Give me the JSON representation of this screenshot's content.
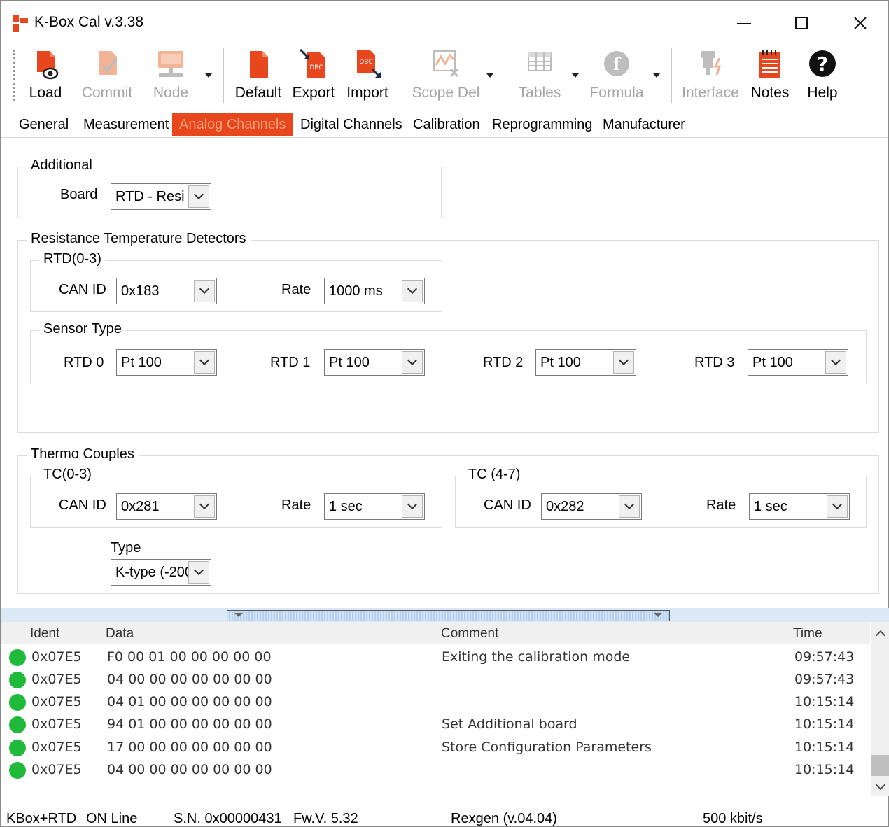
{
  "window": {
    "title": "K-Box Cal v.3.38",
    "controls": {
      "minimize": "minimize-icon",
      "maximize": "maximize-icon",
      "close": "close-icon"
    }
  },
  "toolbar": {
    "load": "Load",
    "commit": "Commit",
    "node": "Node",
    "default": "Default",
    "export": "Export",
    "import": "Import",
    "scope_del": "Scope Del",
    "tables": "Tables",
    "formula": "Formula",
    "interface": "Interface",
    "notes": "Notes",
    "help": "Help",
    "dbc_badge": "DBC"
  },
  "tabs": [
    "General",
    "Measurement",
    "Analog Channels",
    "Digital Channels",
    "Calibration",
    "Reprogramming",
    "Manufacturer"
  ],
  "active_tab": "Analog Channels",
  "additional": {
    "title": "Additional",
    "board_label": "Board",
    "board_value": "RTD - Resi"
  },
  "rtd": {
    "title": "Resistance Temperature Detectors",
    "group_title": "RTD(0-3)",
    "can_id_label": "CAN ID",
    "can_id_value": "0x183",
    "rate_label": "Rate",
    "rate_value": "1000 ms",
    "sensor_type_title": "Sensor Type",
    "sensors": [
      {
        "label": "RTD 0",
        "value": "Pt 100"
      },
      {
        "label": "RTD 1",
        "value": "Pt 100"
      },
      {
        "label": "RTD 2",
        "value": "Pt 100"
      },
      {
        "label": "RTD 3",
        "value": "Pt 100"
      }
    ]
  },
  "thermo": {
    "title": "Thermo Couples",
    "tc03": {
      "title": "TC(0-3)",
      "can_id_label": "CAN ID",
      "can_id_value": "0x281",
      "rate_label": "Rate",
      "rate_value": "1 sec"
    },
    "tc47": {
      "title": "TC (4-7)",
      "can_id_label": "CAN ID",
      "can_id_value": "0x282",
      "rate_label": "Rate",
      "rate_value": "1 sec"
    },
    "type_label": "Type",
    "type_value": "K-type (-200"
  },
  "log": {
    "headers": {
      "ident": "Ident",
      "data": "Data",
      "comment": "Comment",
      "time": "Time"
    },
    "rows": [
      {
        "ident": "0x07E5",
        "data": "F0 00 01 00 00 00 00 00",
        "comment": "Exiting the calibration mode",
        "time": "09:57:43"
      },
      {
        "ident": "0x07E5",
        "data": "04 00 00 00 00 00 00 00",
        "comment": "",
        "time": "09:57:43"
      },
      {
        "ident": "0x07E5",
        "data": "04 01 00 00 00 00 00 00",
        "comment": "",
        "time": "10:15:14"
      },
      {
        "ident": "0x07E5",
        "data": "94 01 00 00 00 00 00 00",
        "comment": "Set Additional board",
        "time": "10:15:14"
      },
      {
        "ident": "0x07E5",
        "data": "17 00 00 00 00 00 00 00",
        "comment": "Store Configuration Parameters",
        "time": "10:15:14"
      },
      {
        "ident": "0x07E5",
        "data": "04 00 00 00 00 00 00 00",
        "comment": "",
        "time": "10:15:14"
      }
    ],
    "status_color": "#1fba3a"
  },
  "statusbar": {
    "device": "KBox+RTD",
    "state": "ON Line",
    "serial": "S.N. 0x00000431",
    "firmware": "Fw.V. 5.32",
    "interface": "Rexgen (v.04.04)",
    "bitrate": "500 kbit/s"
  },
  "colors": {
    "accent": "#e8461c",
    "tab_active_text": "#f4a07a",
    "online_green": "#1fba3a"
  }
}
